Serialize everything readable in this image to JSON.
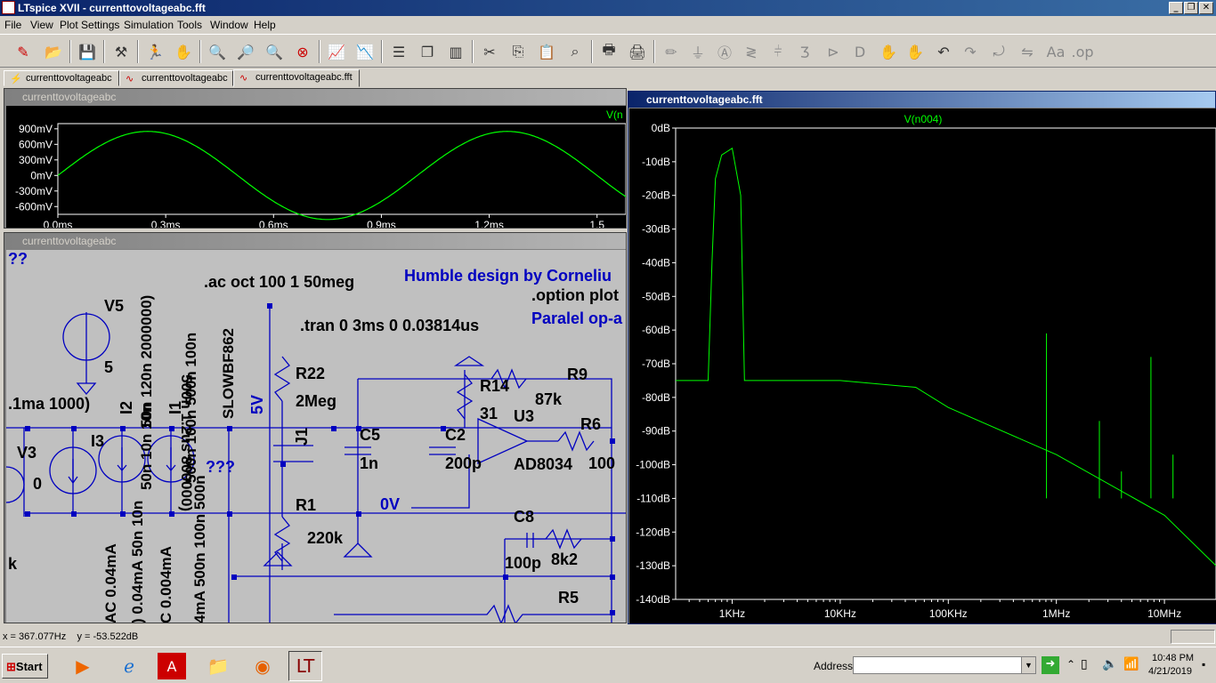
{
  "window": {
    "title": "LTspice XVII - currenttovoltageabc.fft",
    "min": "_",
    "restore": "❐",
    "close": "✕"
  },
  "menu": [
    "File",
    "View",
    "Plot Settings",
    "Simulation",
    "Tools",
    "Window",
    "Help"
  ],
  "tabs": [
    {
      "label": "currenttovoltageabc",
      "icon": "schematic-icon"
    },
    {
      "label": "currenttovoltageabc",
      "icon": "waveform-icon"
    },
    {
      "label": "currenttovoltageabc.fft",
      "icon": "waveform-icon"
    }
  ],
  "timeplot": {
    "title": "currenttovoltageabc",
    "trace": "V(n",
    "yticks": [
      "900mV",
      "600mV",
      "300mV",
      "0mV",
      "-300mV",
      "-600mV"
    ],
    "xticks": [
      "0.0ms",
      "0.3ms",
      "0.6ms",
      "0.9ms",
      "1.2ms",
      "1.5"
    ],
    "trace_color": "#00ff00"
  },
  "schematic": {
    "title": "currenttovoltageabc",
    "texts": {
      "qq": "??",
      "v5": "V5",
      "v5val": "5",
      "sim1": ".ac oct 100 1 50meg",
      "tran": ".tran 0 3ms 0 0.03814us",
      "humble": "Humble design by Corneliu",
      "option": ".option plot",
      "paralel": "Paralel op-a",
      "r22": "R22",
      "r22v": "2Meg",
      "r14": "R14",
      "r14v": "31",
      "r9": "R9",
      "r9v": "87k",
      "u3": "U3",
      "r6": "R6",
      "r6v": "100",
      "ad": "AD8034",
      "j1": "J1",
      "c5": "C5",
      "c5v": "1n",
      "c2": "C2",
      "c2v": "200p",
      "v5net": "5V",
      "vert1": "500n 1.2us 800000)",
      "vert2": "SLOWBF862",
      "vert3": "50n 120n 2000000)",
      "vert4": "500n 100n 500n 100n",
      "vert5": "50n 10n 10n",
      "i1": "I1",
      "i2": "I2",
      "i3": "I3",
      "ma": ".1ma 1000)",
      "v3": "V3",
      "v3v": "0",
      "qqq": "???",
      "r1": "R1",
      "r1v": "220k",
      "zerov": "0V",
      "c8": "C8",
      "c8v": "100p",
      "r5v": "8k2",
      "r5": "R5",
      "k": "k",
      "va1": "AC 0.04mA",
      "va2": ") 0.04mA 50n 10n",
      "va3": "C 0.004mA",
      "va4": "4mA 500n 100n 500n"
    }
  },
  "fft": {
    "title": "currenttovoltageabc.fft",
    "trace": "V(n004)",
    "yticks": [
      "0dB",
      "-10dB",
      "-20dB",
      "-30dB",
      "-40dB",
      "-50dB",
      "-60dB",
      "-70dB",
      "-80dB",
      "-90dB",
      "-100dB",
      "-110dB",
      "-120dB",
      "-130dB",
      "-140dB"
    ],
    "xticks": [
      "1KHz",
      "10KHz",
      "100KHz",
      "1MHz",
      "10MHz"
    ],
    "trace_color": "#00ff00"
  },
  "chart_data": [
    {
      "type": "line",
      "title": "",
      "series": [
        {
          "name": "V(n",
          "x": [
            0,
            0.25,
            0.5,
            0.75,
            1.0,
            1.25,
            1.5
          ],
          "y": [
            0.0,
            0.8,
            0.0,
            -0.8,
            0.0,
            0.8,
            0.0
          ]
        }
      ],
      "xlabel": "",
      "ylabel": "",
      "xlim": [
        0,
        1.58
      ],
      "ylim": [
        -750,
        1000
      ],
      "grid": false
    },
    {
      "type": "line",
      "title": "",
      "series": [
        {
          "name": "V(n004)",
          "x": [
            300,
            600,
            650,
            700,
            800,
            1000,
            1200,
            1300,
            1500,
            10000,
            50000,
            100000,
            1000000,
            10000000,
            30000000
          ],
          "y": [
            -75,
            -75,
            -40,
            -15,
            -8,
            -6,
            -20,
            -75,
            -75,
            -75,
            -77,
            -83,
            -97,
            -115,
            -130
          ]
        }
      ],
      "xlabel": "",
      "ylabel": "",
      "xscale": "log",
      "xlim": [
        300,
        30000000
      ],
      "ylim": [
        -140,
        0
      ],
      "grid": false
    }
  ],
  "status": {
    "coords": "x = 367.077Hz    y = -53.522dB"
  },
  "taskbar": {
    "start": "Start",
    "address_label": "Address",
    "time": "10:48 PM",
    "date": "4/21/2019"
  }
}
